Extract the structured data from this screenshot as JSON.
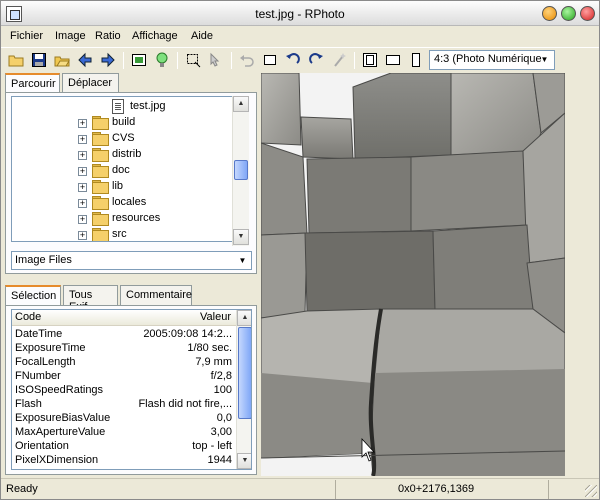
{
  "window": {
    "title": "test.jpg - RPhoto"
  },
  "menu": {
    "items": [
      "Fichier",
      "Image",
      "Ratio",
      "Affichage",
      "Aide"
    ]
  },
  "toolbar": {
    "buttons": [
      "open-folder-icon",
      "save-icon",
      "open-icon",
      "back-arrow-icon",
      "forward-arrow-icon",
      "fit-view-icon",
      "bulb-icon",
      "crop-select-icon",
      "cursor-select-icon",
      "undo-icon",
      "rect-icon",
      "rotate-left-icon",
      "rotate-right-icon",
      "magic-wand-icon",
      "portrait-frame-icon",
      "landscape-icon",
      "portrait-icon"
    ],
    "ratio_value": "4:3 (Photo Numérique"
  },
  "left": {
    "tabs_top": [
      "Parcourir",
      "Déplacer"
    ],
    "tree": [
      {
        "label": "test.jpg",
        "type": "file"
      },
      {
        "label": "build",
        "type": "folder"
      },
      {
        "label": "CVS",
        "type": "folder"
      },
      {
        "label": "distrib",
        "type": "folder"
      },
      {
        "label": "doc",
        "type": "folder"
      },
      {
        "label": "lib",
        "type": "folder"
      },
      {
        "label": "locales",
        "type": "folder"
      },
      {
        "label": "resources",
        "type": "folder"
      },
      {
        "label": "src",
        "type": "folder"
      }
    ],
    "filter_value": "Image Files",
    "tabs_bottom": [
      "Sélection",
      "Tous Exif",
      "Commentaire"
    ],
    "exif_headers": {
      "code": "Code",
      "value": "Valeur"
    },
    "exif_rows": [
      {
        "code": "DateTime",
        "value": "2005:09:08 14:2..."
      },
      {
        "code": "ExposureTime",
        "value": "1/80 sec."
      },
      {
        "code": "FocalLength",
        "value": "7,9 mm"
      },
      {
        "code": "FNumber",
        "value": "f/2,8"
      },
      {
        "code": "ISOSpeedRatings",
        "value": "100"
      },
      {
        "code": "Flash",
        "value": "Flash did not fire,..."
      },
      {
        "code": "ExposureBiasValue",
        "value": "0,0"
      },
      {
        "code": "MaxApertureValue",
        "value": "3,00"
      },
      {
        "code": "Orientation",
        "value": "top - left"
      },
      {
        "code": "PixelXDimension",
        "value": "1944"
      }
    ]
  },
  "status": {
    "left": "Ready",
    "coords": "0x0+2176,1369"
  },
  "colors": {
    "tab_accent": "#e68b2c",
    "scroll_thumb": "#7fa7f7",
    "folder": "#f5d06a"
  }
}
